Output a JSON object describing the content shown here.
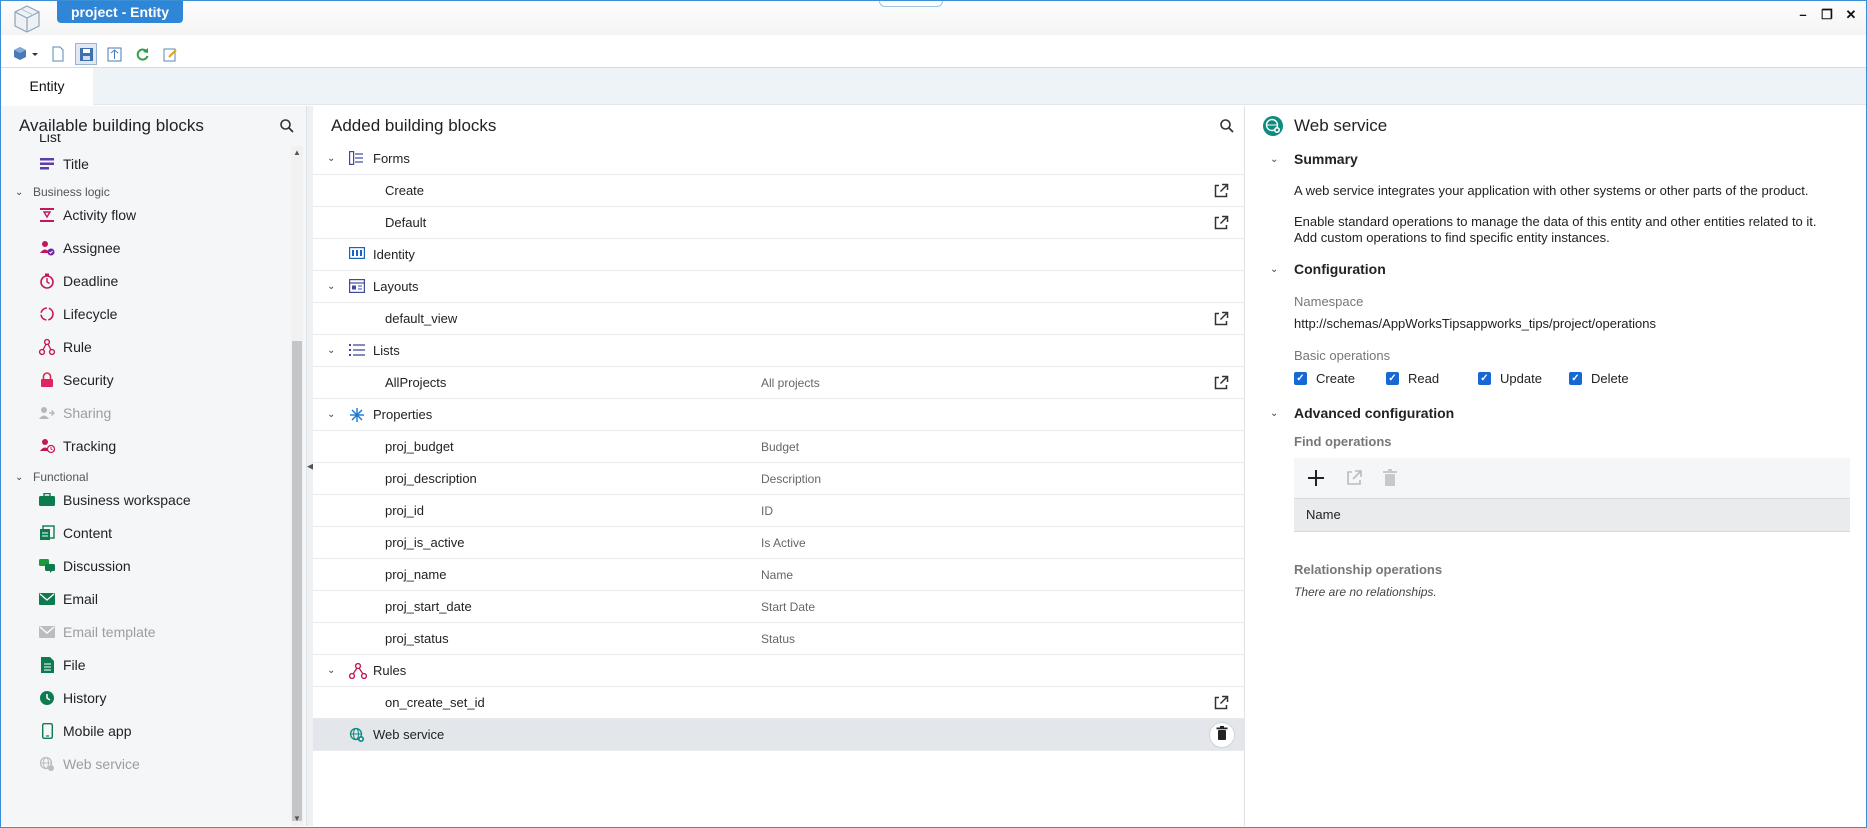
{
  "window": {
    "title": "project - Entity",
    "controls": [
      "minimize-icon",
      "restore-icon",
      "close-icon"
    ]
  },
  "toolbar": {
    "icons": [
      "cube-menu-icon",
      "new-document-icon",
      "save-icon",
      "publish-icon",
      "refresh-icon",
      "edit-icon"
    ]
  },
  "tabs": {
    "entity": "Entity"
  },
  "left_panel": {
    "title": "Available building blocks",
    "partial_item": "List",
    "items_top": [
      {
        "label": "Title",
        "icon": "title-icon"
      }
    ],
    "groups": [
      {
        "label": "Business logic",
        "items": [
          {
            "label": "Activity flow",
            "icon": "activity-flow-icon",
            "disabled": false
          },
          {
            "label": "Assignee",
            "icon": "assignee-icon",
            "disabled": false
          },
          {
            "label": "Deadline",
            "icon": "deadline-icon",
            "disabled": false
          },
          {
            "label": "Lifecycle",
            "icon": "lifecycle-icon",
            "disabled": false
          },
          {
            "label": "Rule",
            "icon": "rule-icon",
            "disabled": false
          },
          {
            "label": "Security",
            "icon": "lock-icon",
            "disabled": false
          },
          {
            "label": "Sharing",
            "icon": "sharing-icon",
            "disabled": true
          },
          {
            "label": "Tracking",
            "icon": "tracking-icon",
            "disabled": false
          }
        ]
      },
      {
        "label": "Functional",
        "items": [
          {
            "label": "Business workspace",
            "icon": "briefcase-icon",
            "disabled": false
          },
          {
            "label": "Content",
            "icon": "content-icon",
            "disabled": false
          },
          {
            "label": "Discussion",
            "icon": "discussion-icon",
            "disabled": false
          },
          {
            "label": "Email",
            "icon": "email-icon",
            "disabled": false
          },
          {
            "label": "Email template",
            "icon": "email-template-icon",
            "disabled": true
          },
          {
            "label": "File",
            "icon": "file-icon",
            "disabled": false
          },
          {
            "label": "History",
            "icon": "history-icon",
            "disabled": false
          },
          {
            "label": "Mobile app",
            "icon": "mobile-icon",
            "disabled": false
          },
          {
            "label": "Web service",
            "icon": "web-service-icon",
            "disabled": true
          }
        ]
      }
    ]
  },
  "mid_panel": {
    "title": "Added building blocks",
    "rows": [
      {
        "kind": "group",
        "label": "Forms",
        "icon": "forms-icon",
        "expanded": true
      },
      {
        "kind": "child",
        "label": "Create",
        "desc": "",
        "open": true
      },
      {
        "kind": "child",
        "label": "Default",
        "desc": "",
        "open": true
      },
      {
        "kind": "group",
        "label": "Identity",
        "icon": "identity-icon",
        "expanded": null
      },
      {
        "kind": "group",
        "label": "Layouts",
        "icon": "layouts-icon",
        "expanded": true
      },
      {
        "kind": "child",
        "label": "default_view",
        "desc": "",
        "open": true
      },
      {
        "kind": "group",
        "label": "Lists",
        "icon": "lists-icon",
        "expanded": true
      },
      {
        "kind": "child",
        "label": "AllProjects",
        "desc": "All projects",
        "open": true
      },
      {
        "kind": "group",
        "label": "Properties",
        "icon": "properties-icon",
        "expanded": true
      },
      {
        "kind": "child",
        "label": "proj_budget",
        "desc": "Budget",
        "open": false
      },
      {
        "kind": "child",
        "label": "proj_description",
        "desc": "Description",
        "open": false
      },
      {
        "kind": "child",
        "label": "proj_id",
        "desc": "ID",
        "open": false
      },
      {
        "kind": "child",
        "label": "proj_is_active",
        "desc": "Is Active",
        "open": false
      },
      {
        "kind": "child",
        "label": "proj_name",
        "desc": "Name",
        "open": false
      },
      {
        "kind": "child",
        "label": "proj_start_date",
        "desc": "Start Date",
        "open": false
      },
      {
        "kind": "child",
        "label": "proj_status",
        "desc": "Status",
        "open": false
      },
      {
        "kind": "group",
        "label": "Rules",
        "icon": "rules-icon",
        "expanded": true
      },
      {
        "kind": "child",
        "label": "on_create_set_id",
        "desc": "",
        "open": true
      },
      {
        "kind": "group",
        "label": "Web service",
        "icon": "web-service-icon",
        "expanded": null,
        "selected": true
      }
    ]
  },
  "right_panel": {
    "title": "Web service",
    "summary": {
      "heading": "Summary",
      "p1": "A web service integrates your application with other systems or other parts of the product.",
      "p2a": "Enable standard operations to manage the data of this entity and other entities related to it.",
      "p2b": "Add custom operations to find specific entity instances."
    },
    "configuration": {
      "heading": "Configuration",
      "namespace_label": "Namespace",
      "namespace_value": "http://schemas/AppWorksTipsappworks_tips/project/operations",
      "basic_ops_label": "Basic operations",
      "ops": [
        {
          "label": "Create",
          "checked": true
        },
        {
          "label": "Read",
          "checked": true
        },
        {
          "label": "Update",
          "checked": true
        },
        {
          "label": "Delete",
          "checked": true
        }
      ]
    },
    "advanced": {
      "heading": "Advanced configuration",
      "find_ops_label": "Find operations",
      "table_header": "Name",
      "relationship_label": "Relationship operations",
      "no_relationships": "There are no relationships."
    }
  }
}
